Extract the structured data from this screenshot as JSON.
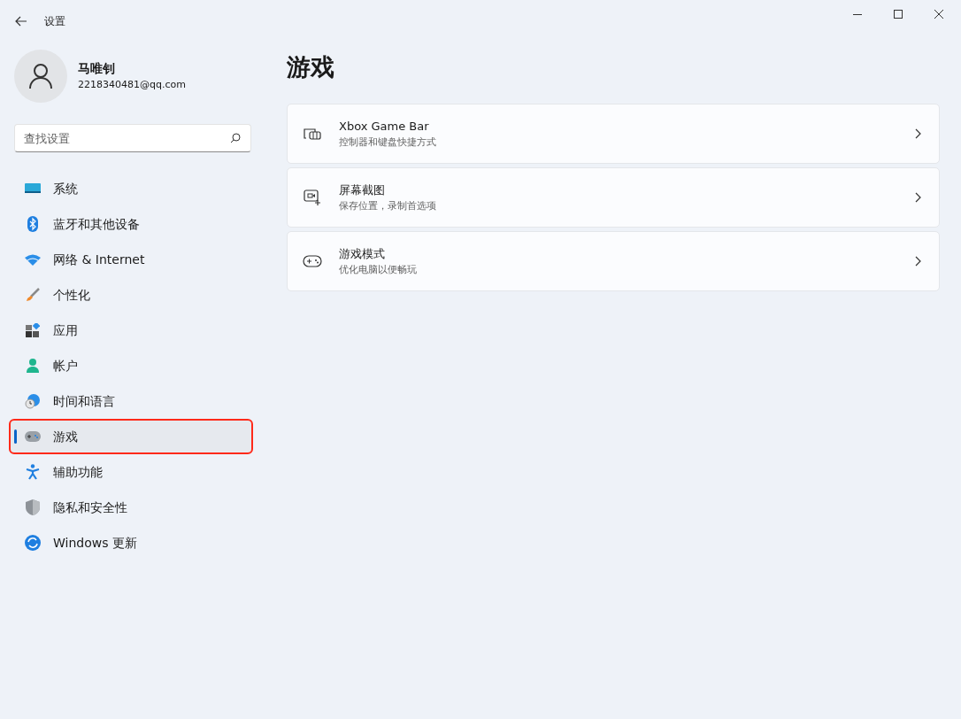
{
  "window": {
    "title": "设置"
  },
  "user": {
    "name": "马唯钊",
    "email": "2218340481@qq.com"
  },
  "search": {
    "placeholder": "查找设置"
  },
  "nav": [
    {
      "label": "系统",
      "selected": false,
      "outlined": false
    },
    {
      "label": "蓝牙和其他设备",
      "selected": false,
      "outlined": false
    },
    {
      "label": "网络 & Internet",
      "selected": false,
      "outlined": false
    },
    {
      "label": "个性化",
      "selected": false,
      "outlined": false
    },
    {
      "label": "应用",
      "selected": false,
      "outlined": false
    },
    {
      "label": "帐户",
      "selected": false,
      "outlined": false
    },
    {
      "label": "时间和语言",
      "selected": false,
      "outlined": false
    },
    {
      "label": "游戏",
      "selected": true,
      "outlined": true
    },
    {
      "label": "辅助功能",
      "selected": false,
      "outlined": false
    },
    {
      "label": "隐私和安全性",
      "selected": false,
      "outlined": false
    },
    {
      "label": "Windows 更新",
      "selected": false,
      "outlined": false
    }
  ],
  "page": {
    "title": "游戏",
    "cards": [
      {
        "title": "Xbox Game Bar",
        "subtitle": "控制器和键盘快捷方式"
      },
      {
        "title": "屏幕截图",
        "subtitle": "保存位置，录制首选项"
      },
      {
        "title": "游戏模式",
        "subtitle": "优化电脑以便畅玩"
      }
    ]
  }
}
